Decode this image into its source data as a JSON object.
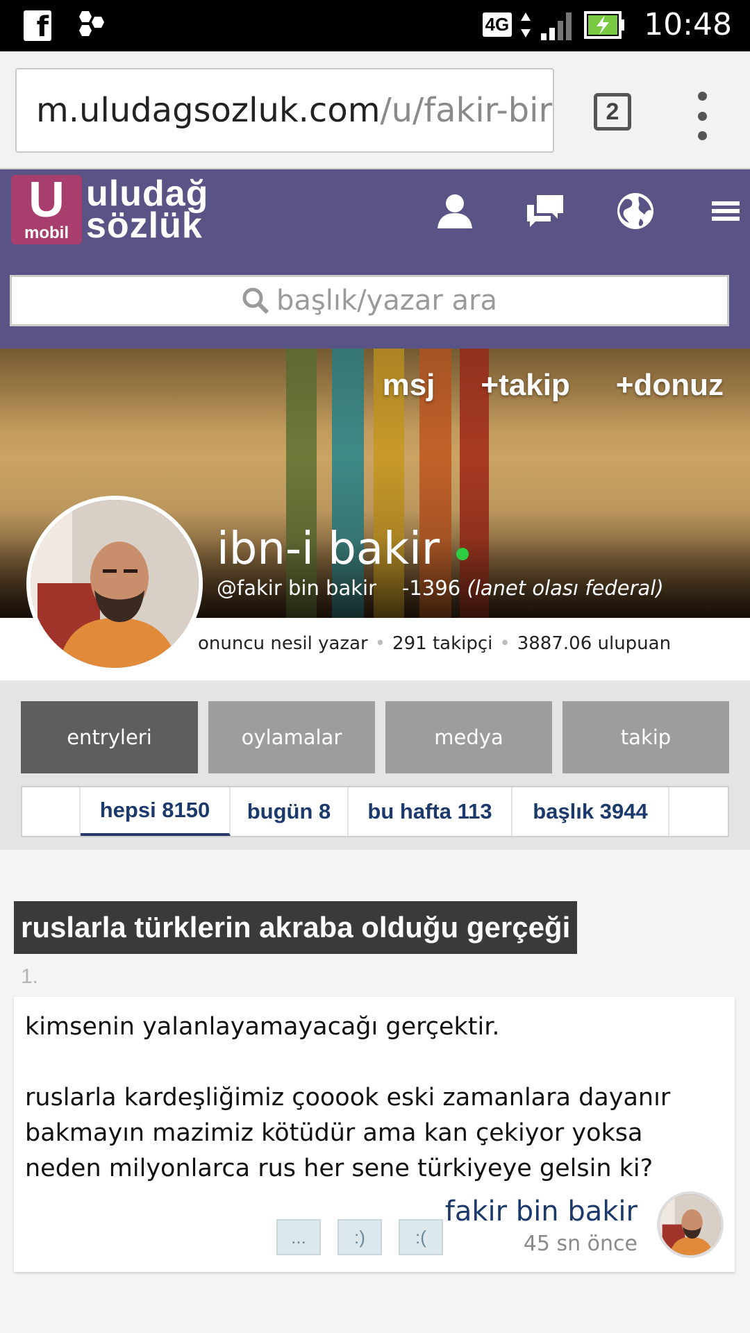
{
  "status_bar": {
    "network": "4G",
    "time": "10:48",
    "icons": [
      "facebook-icon",
      "hexagons-icon",
      "signal-icon",
      "battery-charging-icon"
    ]
  },
  "browser": {
    "url_host": "m.uludagsozluk.com",
    "url_path": "/u/fakir-bir",
    "tab_count": "2"
  },
  "site": {
    "logo_letter": "U",
    "logo_sub": "mobil",
    "logo_line1": "uludağ",
    "logo_line2": "sözlük",
    "search_placeholder": "başlık/yazar ara",
    "brand_color": "#5a5385",
    "logo_color": "#a83e6e"
  },
  "profile": {
    "actions": {
      "message": "msj",
      "follow": "+takip",
      "donuz": "+donuz"
    },
    "nick": "ibn-i bakir",
    "handle": "@fakir bin bakir",
    "karma_value": "-1396",
    "karma_label": "(lanet olası federal)",
    "generation": "onuncu nesil yazar",
    "followers": "291 takipçi",
    "points": "3887.06 ulupuan",
    "online_color": "#2ecc40"
  },
  "tabs": {
    "main": [
      {
        "label": "entryleri"
      },
      {
        "label": "oylamalar"
      },
      {
        "label": "medya"
      },
      {
        "label": "takip"
      }
    ],
    "sub": [
      {
        "label": "hepsi 8150"
      },
      {
        "label": "bugün 8"
      },
      {
        "label": "bu hafta 113"
      },
      {
        "label": "başlık 3944"
      }
    ]
  },
  "entry": {
    "topic": "ruslarla türklerin akraba olduğu gerçeği",
    "number": "1.",
    "paragraph1": "kimsenin yalanlayamayacağı gerçektir.",
    "paragraph2": "ruslarla kardeşliğimiz çooook eski zamanlara dayanır bakmayın mazimiz kötüdür ama kan çekiyor yoksa neden milyonlarca rus her sene türkiyeye gelsin ki?",
    "vote_more": "...",
    "vote_up": ":)",
    "vote_down": ":(",
    "author": "fakir bin bakir",
    "time": "45 sn önce"
  }
}
